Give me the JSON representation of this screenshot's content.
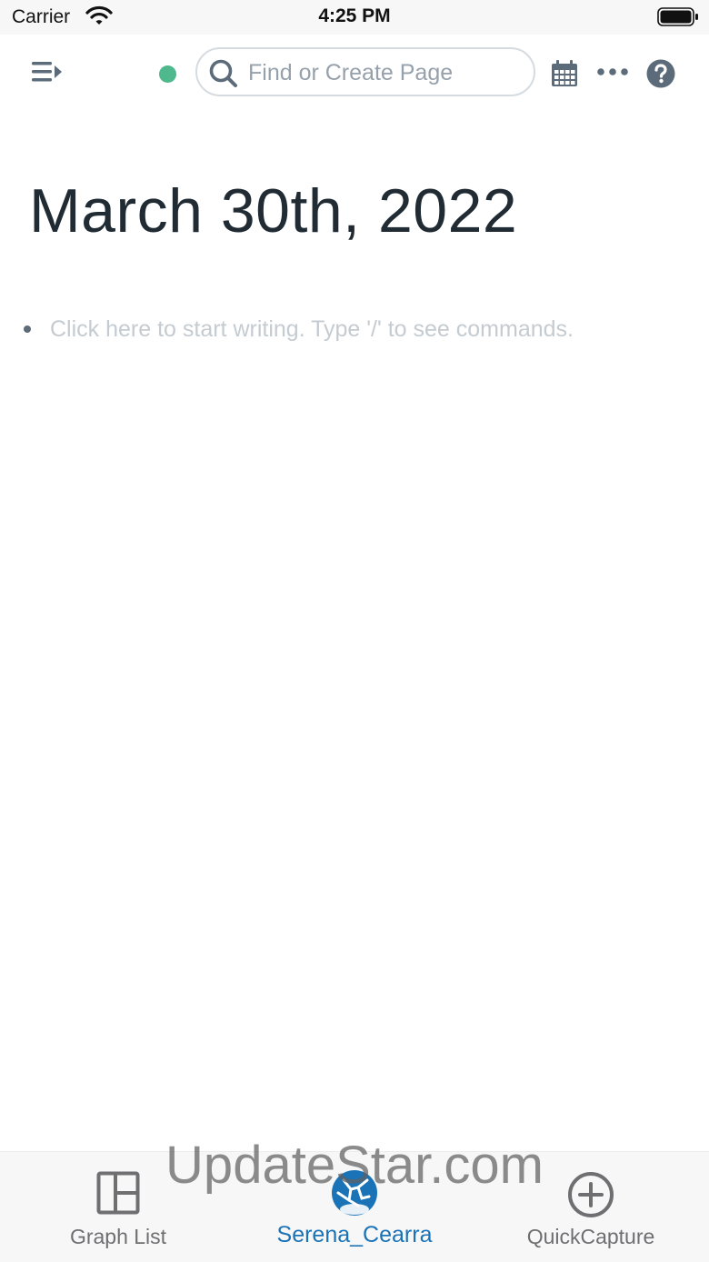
{
  "status_bar": {
    "carrier": "Carrier",
    "time": "4:25 PM",
    "icons": [
      "wifi-icon",
      "battery-icon"
    ]
  },
  "topbar": {
    "icons": [
      "menu-icon",
      "sync-status-dot",
      "search-icon",
      "calendar-icon",
      "more-icon",
      "help-icon"
    ],
    "sync_color": "#4fb88c",
    "search": {
      "placeholder": "Find or Create Page",
      "value": ""
    }
  },
  "page": {
    "title": "March 30th, 2022",
    "block_placeholder": "Click here to start writing. Type '/' to see commands."
  },
  "tabbar": {
    "active_color": "#1a73b6",
    "tabs": [
      {
        "label": "Graph List",
        "icon": "graph-list-icon",
        "active": false
      },
      {
        "label": "Serena_Cearra",
        "icon": "graph-avatar-icon",
        "active": true
      },
      {
        "label": "QuickCapture",
        "icon": "plus-circle-icon",
        "active": false
      }
    ]
  },
  "watermark": "UpdateStar.com"
}
